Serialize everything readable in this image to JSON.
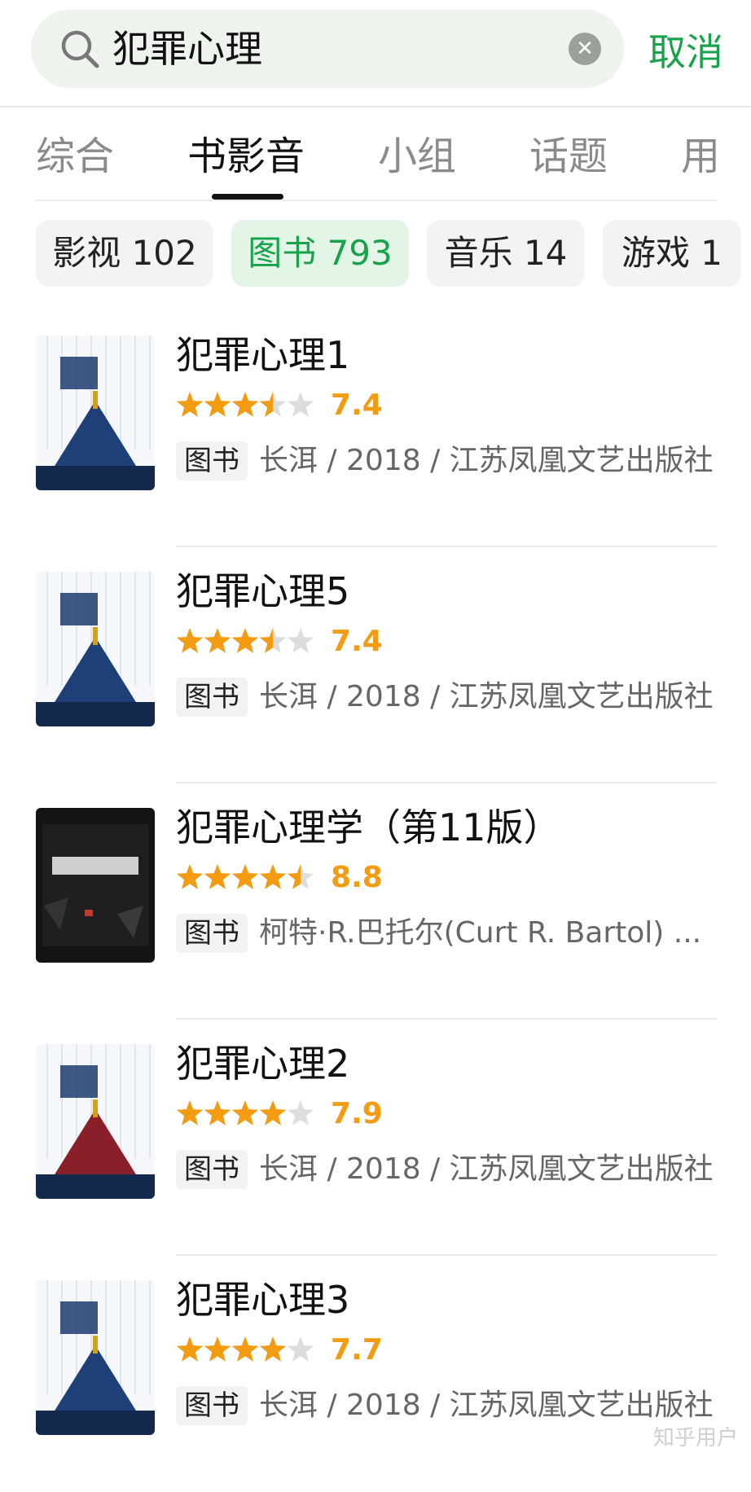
{
  "search": {
    "query": "犯罪心理",
    "cancel_label": "取消"
  },
  "tabs": [
    {
      "label": "综合",
      "active": false
    },
    {
      "label": "书影音",
      "active": true
    },
    {
      "label": "小组",
      "active": false
    },
    {
      "label": "话题",
      "active": false
    },
    {
      "label": "用",
      "active": false
    }
  ],
  "chips": [
    {
      "label": "影视 102",
      "active": false
    },
    {
      "label": "图书 793",
      "active": true
    },
    {
      "label": "音乐 14",
      "active": false
    },
    {
      "label": "游戏 1",
      "active": false
    }
  ],
  "colors": {
    "accent_green": "#18a34a",
    "star_orange": "#f39c12",
    "star_empty": "#dddddd"
  },
  "results": [
    {
      "title": "犯罪心理1",
      "rating_stars": 3.5,
      "score": "7.4",
      "tag": "图书",
      "meta": "长洱 / 2018 / 江苏凤凰文艺出版社",
      "cover_style": "light-blue"
    },
    {
      "title": "犯罪心理5",
      "rating_stars": 3.5,
      "score": "7.4",
      "tag": "图书",
      "meta": "长洱 / 2018 / 江苏凤凰文艺出版社",
      "cover_style": "light-blue"
    },
    {
      "title": "犯罪心理学（第11版）",
      "rating_stars": 4.5,
      "score": "8.8",
      "tag": "图书",
      "meta": "柯特·R.巴托尔(Curt R. Bartol) ...",
      "cover_style": "dark"
    },
    {
      "title": "犯罪心理2",
      "rating_stars": 4,
      "score": "7.9",
      "tag": "图书",
      "meta": "长洱 / 2018 / 江苏凤凰文艺出版社",
      "cover_style": "light-red"
    },
    {
      "title": "犯罪心理3",
      "rating_stars": 4,
      "score": "7.7",
      "tag": "图书",
      "meta": "长洱 / 2018 / 江苏凤凰文艺出版社",
      "cover_style": "light-blue"
    }
  ],
  "watermark": "知乎用户"
}
